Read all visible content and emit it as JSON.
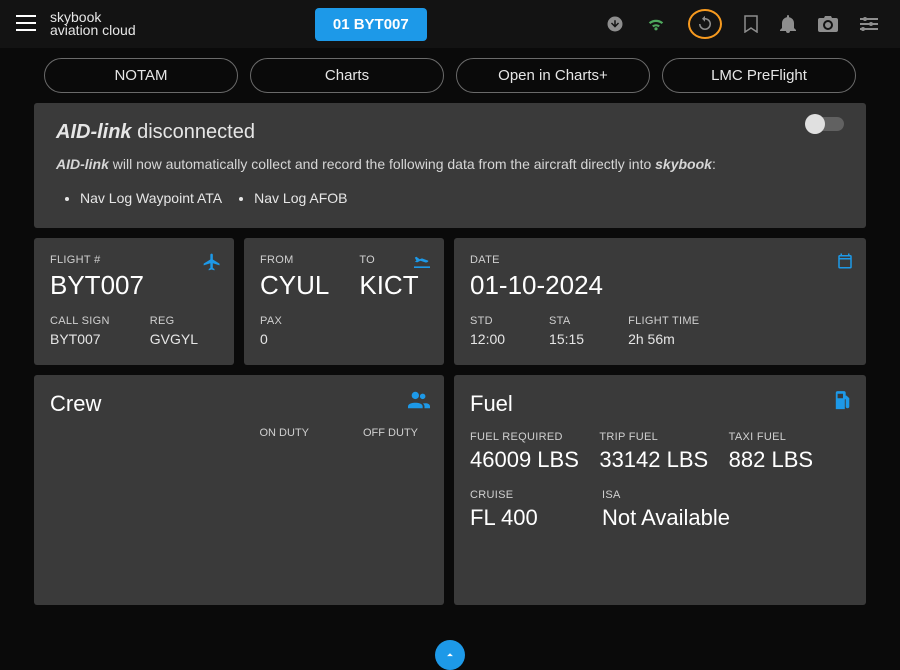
{
  "appbar": {
    "brand_main": "skybook",
    "brand_sub": "aviation cloud",
    "flight_pill": "01 BYT007"
  },
  "tabs": {
    "notam": "NOTAM",
    "charts": "Charts",
    "open_charts_plus": "Open in Charts+",
    "lmc_preflight": "LMC PreFlight"
  },
  "aid": {
    "title_brand": "AID-link",
    "title_status": " disconnected",
    "body_pre": " will now automatically collect and record the following data from the aircraft directly into ",
    "body_brand_lead": "AID-link",
    "body_brand_trail": "skybook",
    "body_suffix": ":",
    "item1": "Nav Log Waypoint ATA",
    "item2": "Nav Log AFOB"
  },
  "flight": {
    "num_label": "FLIGHT #",
    "num": "BYT007",
    "callsign_label": "CALL SIGN",
    "callsign": "BYT007",
    "reg_label": "REG",
    "reg": "GVGYL"
  },
  "route": {
    "from_label": "FROM",
    "from": "CYUL",
    "to_label": "TO",
    "to": "KICT",
    "pax_label": "PAX",
    "pax": "0"
  },
  "datecard": {
    "date_label": "DATE",
    "date": "01-10-2024",
    "std_label": "STD",
    "std": "12:00",
    "sta_label": "STA",
    "sta": "15:15",
    "ftime_label": "FLIGHT TIME",
    "ftime": "2h 56m"
  },
  "crew": {
    "title": "Crew",
    "on_duty": "ON DUTY",
    "off_duty": "OFF DUTY"
  },
  "fuel": {
    "title": "Fuel",
    "req_label": "FUEL REQUIRED",
    "req": "46009 LBS",
    "trip_label": "TRIP FUEL",
    "trip": "33142 LBS",
    "taxi_label": "TAXI FUEL",
    "taxi": "882 LBS",
    "cruise_label": "CRUISE",
    "cruise": "FL 400",
    "isa_label": "ISA",
    "isa": "Not Available"
  }
}
